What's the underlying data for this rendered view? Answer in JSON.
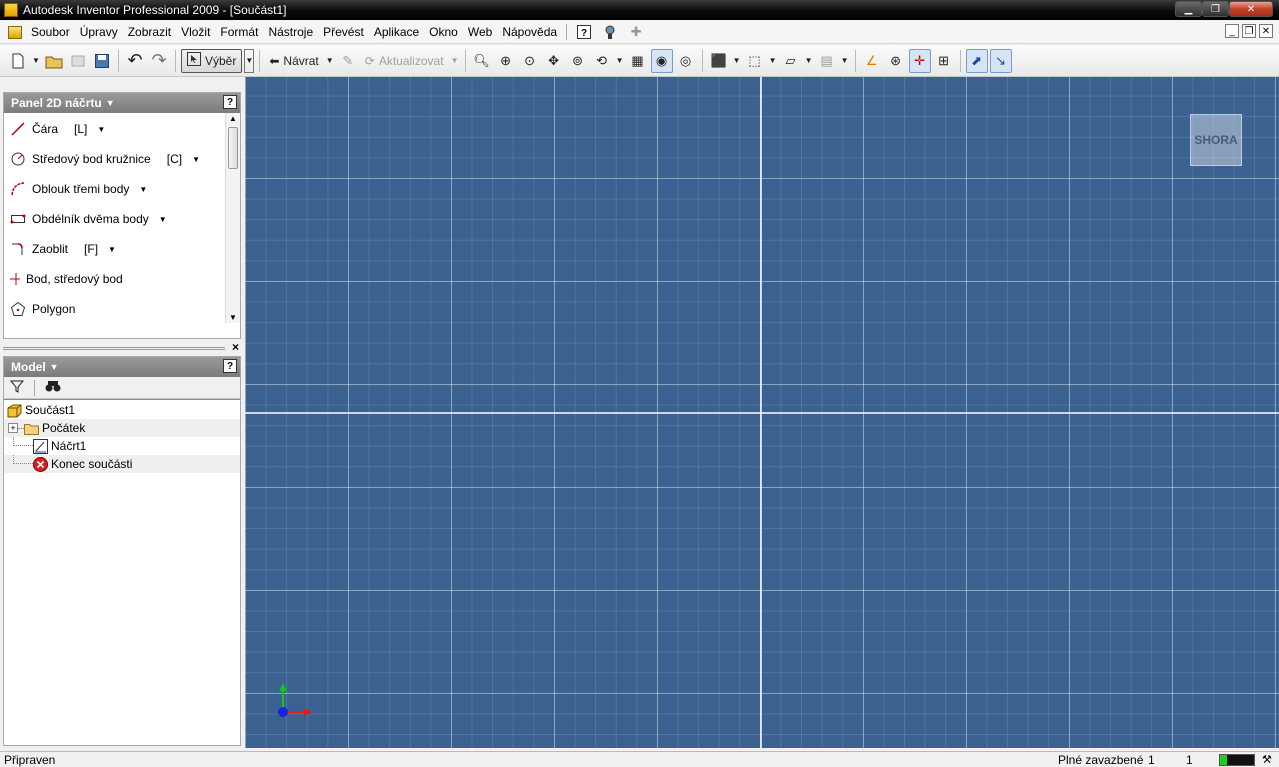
{
  "window": {
    "title": "Autodesk Inventor Professional 2009 - [Součást1]"
  },
  "menu": {
    "items": [
      "Soubor",
      "Úpravy",
      "Zobrazit",
      "Vložit",
      "Formát",
      "Nástroje",
      "Převést",
      "Aplikace",
      "Okno",
      "Web",
      "Nápověda"
    ]
  },
  "toolbar": {
    "select_label": "Výběr",
    "return_label": "Návrat",
    "update_label": "Aktualizovat"
  },
  "sketch_panel": {
    "title": "Panel 2D náčrtu",
    "items": [
      {
        "label": "Čára",
        "shortcut": "[L]",
        "icon": "line-icon"
      },
      {
        "label": "Středový bod kružnice",
        "shortcut": "[C]",
        "icon": "circle-icon"
      },
      {
        "label": "Oblouk třemi body",
        "shortcut": "",
        "icon": "arc-icon"
      },
      {
        "label": "Obdélník dvěma body",
        "shortcut": "",
        "icon": "rectangle-icon"
      },
      {
        "label": "Zaoblit",
        "shortcut": "[F]",
        "icon": "fillet-icon"
      },
      {
        "label": "Bod, středový bod",
        "shortcut": "",
        "icon": "point-icon"
      },
      {
        "label": "Polygon",
        "shortcut": "",
        "icon": "polygon-icon"
      }
    ]
  },
  "model_panel": {
    "title": "Model",
    "tree": [
      "Součást1",
      "Počátek",
      "Náčrt1",
      "Konec součásti"
    ]
  },
  "viewport": {
    "viewcube_label": "SHORA",
    "background_color": "#3a6190"
  },
  "status": {
    "message": "Připraven",
    "constraint_label": "Plné zavazbené",
    "value1": "1",
    "value2": "1",
    "progress": 0.2
  }
}
